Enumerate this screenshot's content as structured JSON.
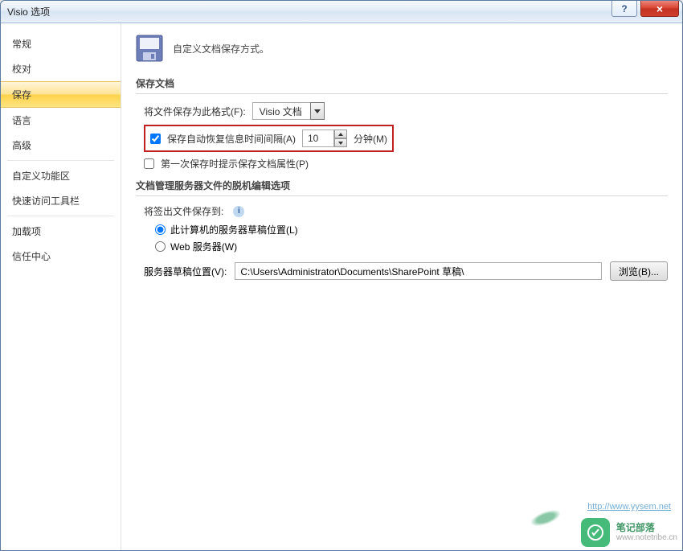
{
  "window": {
    "title": "Visio 选项"
  },
  "sysbtns": {
    "help": "?",
    "close": "×"
  },
  "sidebar": {
    "items": [
      {
        "label": "常规"
      },
      {
        "label": "校对"
      },
      {
        "label": "保存",
        "active": true
      },
      {
        "label": "语言"
      },
      {
        "label": "高级"
      },
      {
        "label": "自定义功能区",
        "sepBefore": true
      },
      {
        "label": "快速访问工具栏"
      },
      {
        "label": "加载项",
        "sepBefore": true
      },
      {
        "label": "信任中心"
      }
    ]
  },
  "main": {
    "header_text": "自定义文档保存方式。",
    "section1_title": "保存文档",
    "save_format_label": "将文件保存为此格式(F):",
    "save_format_value": "Visio 文档",
    "autosave": {
      "checkbox_label": "保存自动恢复信息时间间隔(A)",
      "value": "10",
      "unit": "分钟(M)",
      "checked": true
    },
    "first_save": {
      "label": "第一次保存时提示保存文档属性(P)",
      "checked": false
    },
    "section2_title": "文档管理服务器文件的脱机编辑选项",
    "checkout_label": "将签出文件保存到:",
    "radio1": {
      "label": "此计算机的服务器草稿位置(L)",
      "checked": true
    },
    "radio2": {
      "label": "Web 服务器(W)",
      "checked": false
    },
    "draft_label": "服务器草稿位置(V):",
    "draft_path": "C:\\Users\\Administrator\\Documents\\SharePoint 草稿\\",
    "browse_label": "浏览(B)..."
  },
  "watermark": {
    "title": "笔记部落",
    "sub": "www.notetribe.cn",
    "url": "http://www.yysem.net"
  }
}
